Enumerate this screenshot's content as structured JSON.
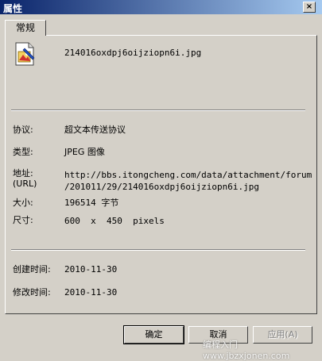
{
  "window": {
    "title": "属性",
    "close_label": "×"
  },
  "tabs": [
    {
      "label": "常规"
    }
  ],
  "file": {
    "name": "214016oxdpj6oijziopn6i.jpg",
    "icon": "jpeg-image-file-icon"
  },
  "properties": {
    "protocol_label": "协议:",
    "protocol_value": "超文本传送协议",
    "type_label": "类型:",
    "type_value": "JPEG 图像",
    "address_label": "地址:",
    "address_label_sub": "(URL)",
    "address_line1": "http://bbs.itongcheng.com/data/attachment/forum",
    "address_line2": "/201011/29/214016oxdpj6oijziopn6i.jpg",
    "size_label": "大小:",
    "size_value": "196514 字节",
    "dimensions_label": "尺寸:",
    "dimensions_value": "600  x  450  pixels",
    "created_label": "创建时间:",
    "created_value": "2010-11-30",
    "modified_label": "修改时间:",
    "modified_value": "2010-11-30"
  },
  "buttons": {
    "ok": "确定",
    "cancel": "取消",
    "apply": "应用(A)"
  },
  "watermark": "编程入门 www.jbzxjonen.com"
}
